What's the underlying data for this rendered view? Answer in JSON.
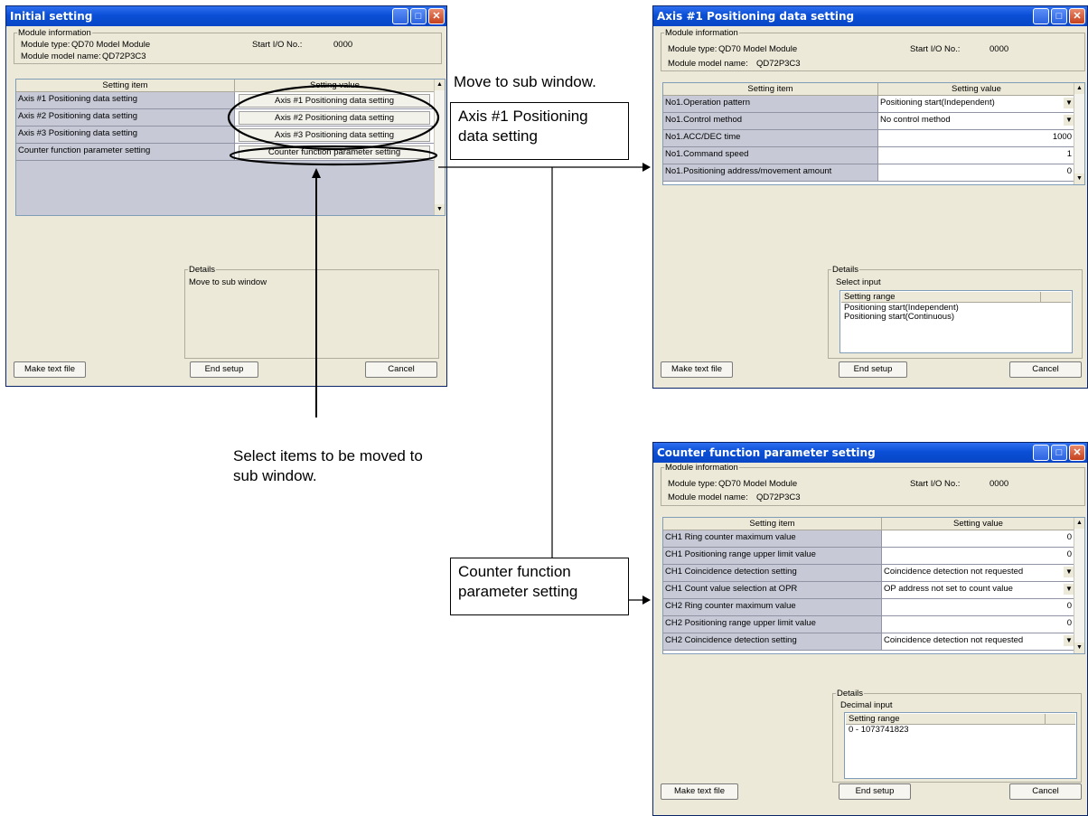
{
  "initial_window": {
    "title": "Initial setting",
    "module_info": {
      "legend": "Module information",
      "type_label": "Module type:",
      "type_value": "QD70 Model Module",
      "io_label": "Start I/O No.:",
      "io_value": "0000",
      "model_label": "Module model name:",
      "model_value": "QD72P3C3"
    },
    "grid": {
      "col_item": "Setting item",
      "col_value": "Setting value",
      "rows": [
        {
          "item": "Axis #1 Positioning data setting",
          "value": "Axis #1 Positioning data setting"
        },
        {
          "item": "Axis #2 Positioning data setting",
          "value": "Axis #2 Positioning data setting"
        },
        {
          "item": "Axis #3 Positioning data setting",
          "value": "Axis #3 Positioning data setting"
        },
        {
          "item": "Counter function parameter setting",
          "value": "Counter function parameter setting"
        }
      ]
    },
    "details": {
      "legend": "Details",
      "text": "Move to sub window"
    },
    "buttons": {
      "make_text": "Make text file",
      "end_setup": "End setup",
      "cancel": "Cancel"
    }
  },
  "axis_window": {
    "title": "Axis #1 Positioning data setting",
    "module_info": {
      "legend": "Module information",
      "type_label": "Module type:",
      "type_value": "QD70 Model Module",
      "io_label": "Start I/O No.:",
      "io_value": "0000",
      "model_label": "Module model name:",
      "model_value": "QD72P3C3"
    },
    "grid": {
      "col_item": "Setting item",
      "col_value": "Setting value",
      "rows": [
        {
          "item": "No1.Operation pattern",
          "value": "Positioning start(Independent)",
          "kind": "dropdown"
        },
        {
          "item": "No1.Control method",
          "value": "No control method",
          "kind": "dropdown"
        },
        {
          "item": "No1.ACC/DEC time",
          "value": "1000",
          "kind": "number"
        },
        {
          "item": "No1.Command speed",
          "value": "1",
          "kind": "number"
        },
        {
          "item": "No1.Positioning address/movement amount",
          "value": "0",
          "kind": "number"
        }
      ]
    },
    "details": {
      "legend": "Details",
      "text": "Select input",
      "range_header": "Setting range",
      "range_items": [
        "Positioning start(Independent)",
        "Positioning start(Continuous)"
      ]
    },
    "buttons": {
      "make_text": "Make text file",
      "end_setup": "End setup",
      "cancel": "Cancel"
    }
  },
  "counter_window": {
    "title": "Counter function parameter setting",
    "module_info": {
      "legend": "Module information",
      "type_label": "Module type:",
      "type_value": "QD70 Model Module",
      "io_label": "Start I/O No.:",
      "io_value": "0000",
      "model_label": "Module model name:",
      "model_value": "QD72P3C3"
    },
    "grid": {
      "col_item": "Setting item",
      "col_value": "Setting value",
      "rows": [
        {
          "item": "CH1 Ring counter maximum value",
          "value": "0",
          "kind": "number"
        },
        {
          "item": "CH1 Positioning range upper limit value",
          "value": "0",
          "kind": "number"
        },
        {
          "item": "CH1 Coincidence detection setting",
          "value": "Coincidence detection not requested",
          "kind": "dropdown"
        },
        {
          "item": "CH1 Count value selection at OPR",
          "value": "OP address not set to count value",
          "kind": "dropdown"
        },
        {
          "item": "CH2 Ring counter maximum value",
          "value": "0",
          "kind": "number"
        },
        {
          "item": "CH2 Positioning range upper limit value",
          "value": "0",
          "kind": "number"
        },
        {
          "item": "CH2 Coincidence detection setting",
          "value": "Coincidence detection not requested",
          "kind": "dropdown"
        }
      ]
    },
    "details": {
      "legend": "Details",
      "text": "Decimal input",
      "range_header": "Setting range",
      "range_items": [
        "0 - 1073741823"
      ]
    },
    "buttons": {
      "make_text": "Make text file",
      "end_setup": "End setup",
      "cancel": "Cancel"
    }
  },
  "annotations": {
    "move_to_sub": "Move to sub window.",
    "axis_box": "Axis #1 Positioning data setting",
    "select_items": "Select items to be moved to sub window.",
    "counter_box": "Counter function parameter setting"
  }
}
